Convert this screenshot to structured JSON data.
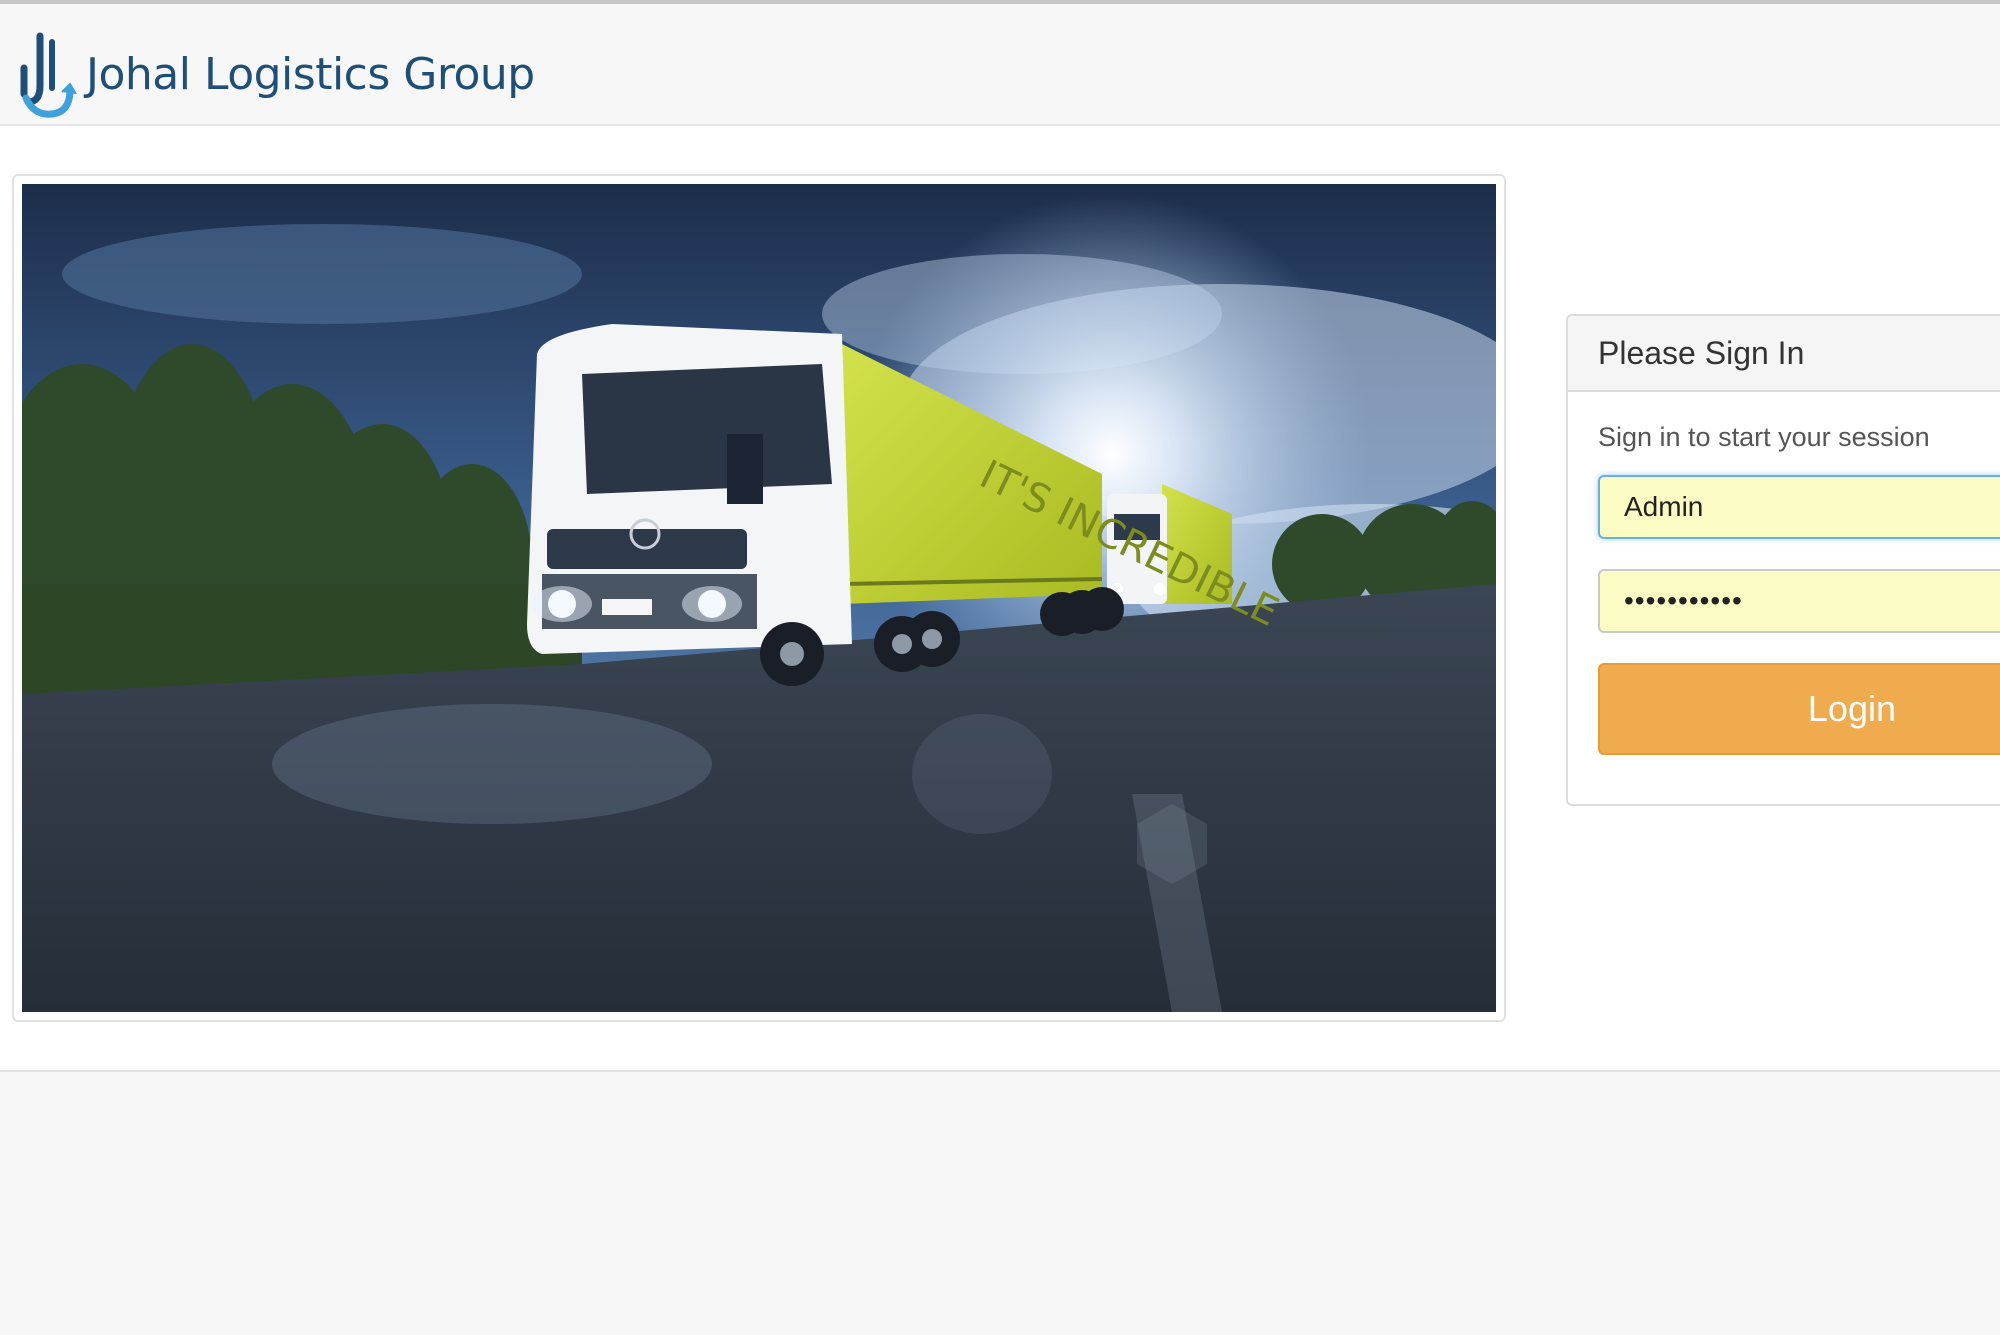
{
  "brand": {
    "name": "Johal Logistics Group",
    "logo_icon": "jlg-logo-icon",
    "color": "#1d4f78",
    "accent": "#3ea0dc"
  },
  "hero": {
    "alt": "Truck image",
    "truck_text": "IT'S INCREDIBLE"
  },
  "signin": {
    "heading": "Please Sign In",
    "message": "Sign in to start your session",
    "username_value": "Admin",
    "password_value": "•••••••••••",
    "login_label": "Login",
    "button_color": "#efab4e",
    "field_bg": "#fbfbc4"
  }
}
